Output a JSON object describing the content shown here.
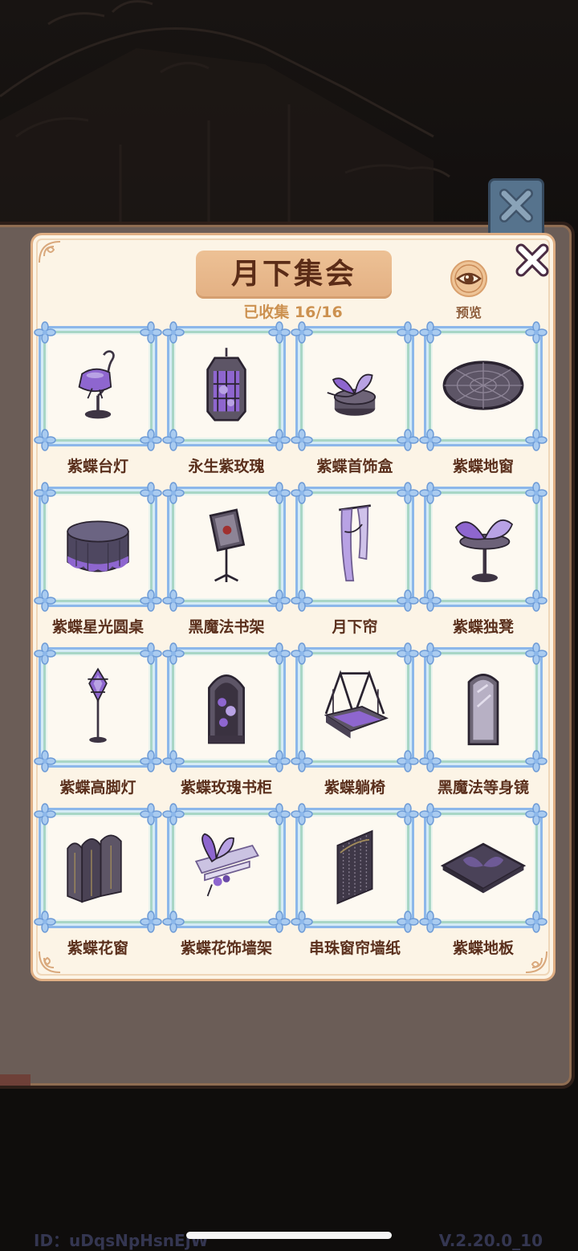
{
  "title": "月下集会",
  "collected": "已收集 16/16",
  "preview_label": "预览",
  "items": [
    {
      "name": "紫蝶台灯",
      "icon": "butterfly-table-lamp-icon"
    },
    {
      "name": "永生紫玫瑰",
      "icon": "eternal-rose-lantern-icon"
    },
    {
      "name": "紫蝶首饰盒",
      "icon": "butterfly-jewelry-box-icon"
    },
    {
      "name": "紫蝶地窗",
      "icon": "butterfly-floor-window-icon"
    },
    {
      "name": "紫蝶星光圆桌",
      "icon": "round-table-icon"
    },
    {
      "name": "黑魔法书架",
      "icon": "book-stand-icon"
    },
    {
      "name": "月下帘",
      "icon": "curtain-icon"
    },
    {
      "name": "紫蝶独凳",
      "icon": "butterfly-stool-icon"
    },
    {
      "name": "紫蝶高脚灯",
      "icon": "floor-lamp-icon"
    },
    {
      "name": "紫蝶玫瑰书柜",
      "icon": "bookcase-icon"
    },
    {
      "name": "紫蝶躺椅",
      "icon": "swing-chair-icon"
    },
    {
      "name": "黑魔法等身镜",
      "icon": "full-length-mirror-icon"
    },
    {
      "name": "紫蝶花窗",
      "icon": "folding-screen-icon"
    },
    {
      "name": "紫蝶花饰墙架",
      "icon": "wall-shelf-icon"
    },
    {
      "name": "串珠窗帘墙纸",
      "icon": "bead-curtain-wallpaper-icon"
    },
    {
      "name": "紫蝶地板",
      "icon": "floor-tile-icon"
    }
  ],
  "footer": {
    "id_text": "ID：uDqsNpHsnEjW",
    "version": "V.2.20.0_10"
  },
  "colors": {
    "panel_bg": "#fcf4e6",
    "title_badge": "#e9bb8d",
    "title_text": "#5b2c17",
    "collected_text": "#cc9150",
    "card_border": "#8cb7ea",
    "accent_purple": "#8e66cf"
  }
}
